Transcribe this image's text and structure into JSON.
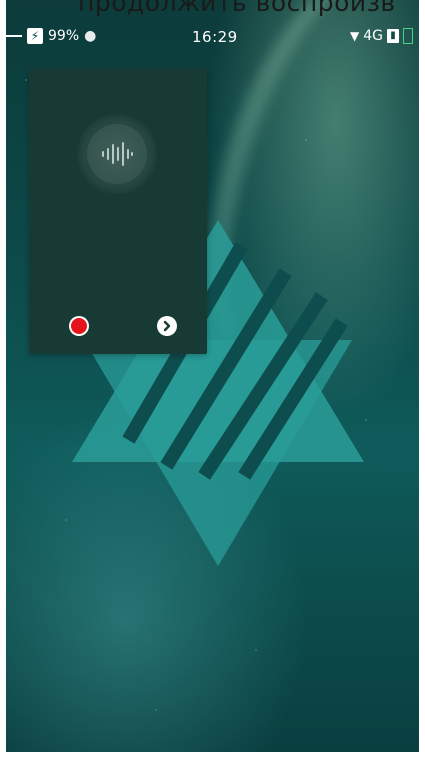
{
  "caption": {
    "text": "продолжить воспроизв"
  },
  "status_bar": {
    "battery_percent": "99%",
    "time": "16:29",
    "network": "4G"
  },
  "recorder_panel": {
    "icons": {
      "waveform": "sound-wave-icon",
      "record": "record-icon",
      "next": "chevron-right-icon"
    },
    "colors": {
      "panel_bg": "#173b34",
      "record": "#e3151a"
    }
  },
  "wallpaper": {
    "logo": "triangle-stripes-logo",
    "accent": "#2a9d99"
  }
}
